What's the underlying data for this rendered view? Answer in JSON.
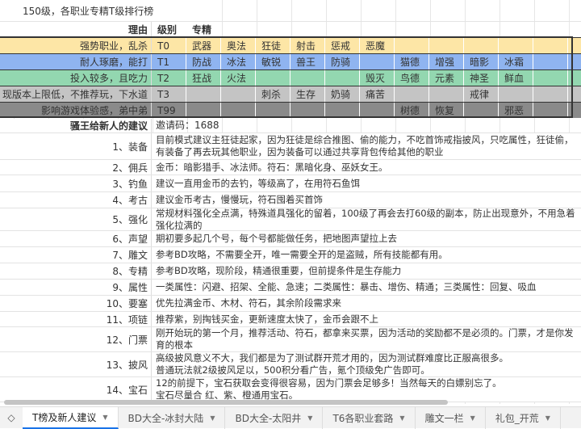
{
  "title": "150级，各职业专精T级排行榜",
  "header": {
    "reason": "理由",
    "level": "级别",
    "spec": "专精"
  },
  "tiers": [
    {
      "reason": "强势职业，乱杀",
      "level": "T0",
      "color": "#fde6a6",
      "cells": [
        "武器",
        "奥法",
        "狂徒",
        "射击",
        "惩戒",
        "恶魔",
        "",
        "",
        "",
        "",
        ""
      ]
    },
    {
      "reason": "耐人琢磨，能打",
      "level": "T1",
      "color": "#8fb4f0",
      "cells": [
        "防战",
        "冰法",
        "敏锐",
        "兽王",
        "防骑",
        "",
        "猫德",
        "增强",
        "暗影",
        "冰霜",
        ""
      ]
    },
    {
      "reason": "投入较多，且吃力",
      "level": "T2",
      "color": "#93d7b0",
      "cells": [
        "狂战",
        "火法",
        "",
        "",
        "",
        "毁灭",
        "鸟德",
        "元素",
        "神圣",
        "鲜血",
        ""
      ]
    },
    {
      "reason": "现版本上限低，不推荐玩，下水道",
      "level": "T3",
      "color": "#c4c4c4",
      "cells": [
        "",
        "",
        "刺杀",
        "生存",
        "奶骑",
        "痛苦",
        "",
        "",
        "戒律",
        "",
        ""
      ]
    },
    {
      "reason": "影响游戏体验感，弟中弟",
      "level": "T99",
      "color": "#8a8a8a",
      "cells": [
        "",
        "",
        "",
        "",
        "",
        "",
        "树德",
        "恢复",
        "",
        "邪恶",
        ""
      ]
    }
  ],
  "advice": {
    "title": "骚王给新人的建议",
    "invite": "邀请码：1688",
    "items": [
      {
        "label": "1、装备",
        "text": "目前模式建议主狂徒起家，因为狂徒是综合推图、偷的能力，不吃首饰戒指披风，只吃属性，狂徒偷，有装备了再去玩其他职业，因为装备可以通过共享背包传给其他的职业"
      },
      {
        "label": "2、佣兵",
        "text": "金币：暗影猎手、冰法师。符石：黑暗化身、巫妖女王。"
      },
      {
        "label": "3、钓鱼",
        "text": "建议一直用金币的去钓，等级高了，在用符石鱼饵"
      },
      {
        "label": "4、考古",
        "text": "建议金币考古，慢慢玩，符石囤着买首饰"
      },
      {
        "label": "5、强化",
        "text": "常规材料强化全点满，特殊道具强化的留着，100级了再会去打60级的副本，防止出现意外，不用急着强化拉满的"
      },
      {
        "label": "6、声望",
        "text": "期初要多起几个号，每个号都能做任务，把地图声望拉上去"
      },
      {
        "label": "7、雕文",
        "text": "参考BD攻略，不需要全开，唯一需要全开的是盗贼，所有技能都有用。"
      },
      {
        "label": "8、专精",
        "text": "参考BD攻略，现阶段，精通很重要，但前提条件是生存能力"
      },
      {
        "label": "9、属性",
        "text": "一类属性：闪避、招架、全能、急速；二类属性：暴击、增伤、精通；三类属性：回复、吸血"
      },
      {
        "label": "10、要塞",
        "text": "优先拉满金币、木材、符石，其余阶段需求来"
      },
      {
        "label": "11、项链",
        "text": "推荐紫，别掏钱买金，更新速度太快了，金币会跟不上"
      },
      {
        "label": "12、门票",
        "text": "刚开始玩的第一个月，推荐活动、符石，都拿来买票，因为活动的奖励都不是必须的。门票，才是你发育的根本"
      },
      {
        "label": "13、披风",
        "text": "高级披风意义不大，我们都是为了测试群开荒才用的，因为测试群难度比正服高很多。\n普通玩法就2级披风足以，500积分看广告，氪个顶级免广告即可。"
      },
      {
        "label": "14、宝石",
        "text": "12的前提下，宝石获取会变得很容易，因为门票会足够多！当然每天的白嫖别忘了。\n宝石尽量合 红、紫、橙通用宝石。"
      }
    ]
  },
  "tabs": [
    {
      "label": "T榜及新人建议",
      "active": true
    },
    {
      "label": "BD大全-冰封大陆"
    },
    {
      "label": "BD大全-太阳井"
    },
    {
      "label": "T6各职业套路"
    },
    {
      "label": "雕文一栏"
    },
    {
      "label": "礼包_开荒"
    }
  ]
}
